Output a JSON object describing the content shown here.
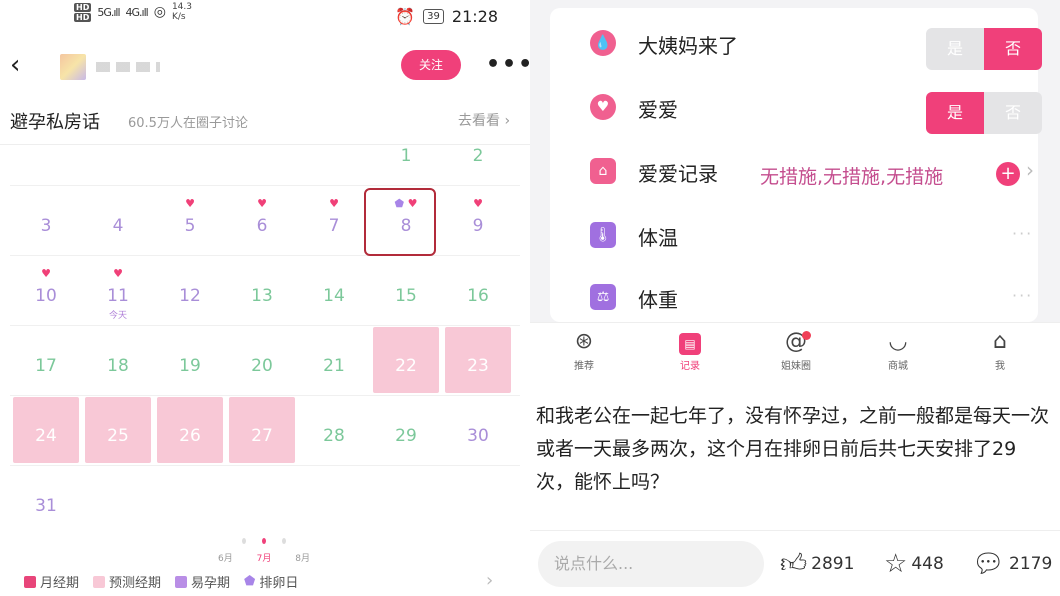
{
  "status": {
    "hd1": "HD",
    "hd2": "HD",
    "sig1": "5G.ıll",
    "sig2": "4G.ıll",
    "speed_value": "14.3",
    "speed_unit": "K/s",
    "battery": "39",
    "time": "21:28"
  },
  "topbar": {
    "follow_label": "关注",
    "more_label": "•••"
  },
  "circle": {
    "title": "避孕私房话",
    "subtitle": "60.5万人在圈子讨论",
    "link": "去看看 ›"
  },
  "calendar": {
    "today_label": "今天",
    "rows": [
      [
        "",
        "",
        "",
        "",
        "",
        "1",
        "2"
      ],
      [
        "3",
        "4",
        "5",
        "6",
        "7",
        "8",
        "9"
      ],
      [
        "10",
        "11",
        "12",
        "13",
        "14",
        "15",
        "16"
      ],
      [
        "17",
        "18",
        "19",
        "20",
        "21",
        "22",
        "23"
      ],
      [
        "24",
        "25",
        "26",
        "27",
        "28",
        "29",
        "30"
      ],
      [
        "31",
        "",
        "",
        "",
        "",
        "",
        ""
      ]
    ]
  },
  "months": [
    "6月",
    "7月",
    "8月"
  ],
  "legend": [
    {
      "label": "月经期",
      "color": "#e8457a"
    },
    {
      "label": "预测经期",
      "color": "#f8c8d6"
    },
    {
      "label": "易孕期",
      "color": "#b98ee6"
    },
    {
      "label": "排卵日",
      "color": "#a885e8"
    }
  ],
  "records": {
    "period": {
      "label": "大姨妈来了",
      "yes": "是",
      "no": "否",
      "selected": "否"
    },
    "love": {
      "label": "爱爱",
      "yes": "是",
      "no": "否",
      "selected": "是"
    },
    "love_log": {
      "label": "爱爱记录",
      "value": "无措施,无措施,无措施"
    },
    "temperature": {
      "label": "体温",
      "value": "···"
    },
    "weight": {
      "label": "体重",
      "value": "···"
    }
  },
  "tabs": [
    {
      "label": "推荐",
      "icon": "recommend-icon"
    },
    {
      "label": "记录",
      "icon": "calendar-icon"
    },
    {
      "label": "姐妹圈",
      "icon": "sisters-icon"
    },
    {
      "label": "商城",
      "icon": "shop-icon"
    },
    {
      "label": "我",
      "icon": "profile-icon"
    }
  ],
  "post": {
    "text": "和我老公在一起七年了，没有怀孕过，之前一般都是每天一次或者一天最多两次，这个月在排卵日前后共七天安排了29次，能怀上吗？"
  },
  "comment": {
    "placeholder": "说点什么...",
    "likes": "2891",
    "favorites": "448",
    "comments": "2179"
  }
}
